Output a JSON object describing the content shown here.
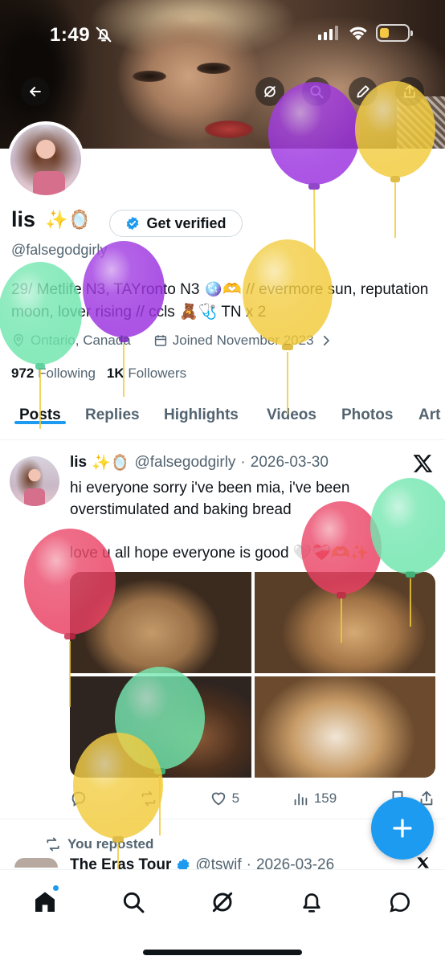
{
  "status_bar": {
    "time": "1:49"
  },
  "profile": {
    "name": "lis",
    "name_emojis": "✨🪞",
    "verify_label": "Get verified",
    "handle": "@falsegodgirly",
    "bio": "29/ Metlife N3, TAYronto N3 🪩🫶 // evermore sun, reputation moon, lover rising // ccls 🧸🩺 TN x 2",
    "location": "Ontario, Canada",
    "joined": "Joined November 2023",
    "following_count": "972",
    "following_label": "Following",
    "followers_count": "1K",
    "followers_label": "Followers"
  },
  "tabs": [
    "Posts",
    "Replies",
    "Highlights",
    "Videos",
    "Photos",
    "Art"
  ],
  "active_tab": "Posts",
  "post": {
    "name": "lis",
    "name_emojis": "✨🪞",
    "handle": "@falsegodgirly",
    "date": "2026-03-30",
    "text": "hi everyone sorry i've been mia, i've been overstimulated and baking bread\n\nlove u all hope everyone is good 🤍❤️‍🩹🫶✨",
    "likes": "5",
    "views": "159"
  },
  "repost": {
    "label": "You reposted",
    "name": "The Eras Tour",
    "handle": "@tswif",
    "date": "2026-03-26"
  },
  "colors": {
    "accent": "#1d9bf0",
    "text": "#0f1419",
    "muted": "#536471",
    "balloon_purple": "#9b30e0",
    "balloon_yellow": "#f2cb3a",
    "balloon_green": "#6ee6ad",
    "balloon_red": "#ea3f62"
  },
  "icons": {
    "back": "arrow-left-icon",
    "grok": "grok-icon",
    "search": "search-icon",
    "edit": "pencil-icon",
    "share": "share-icon",
    "nav": [
      "home-icon",
      "search-icon",
      "grok-icon",
      "bell-icon",
      "messages-icon"
    ]
  }
}
